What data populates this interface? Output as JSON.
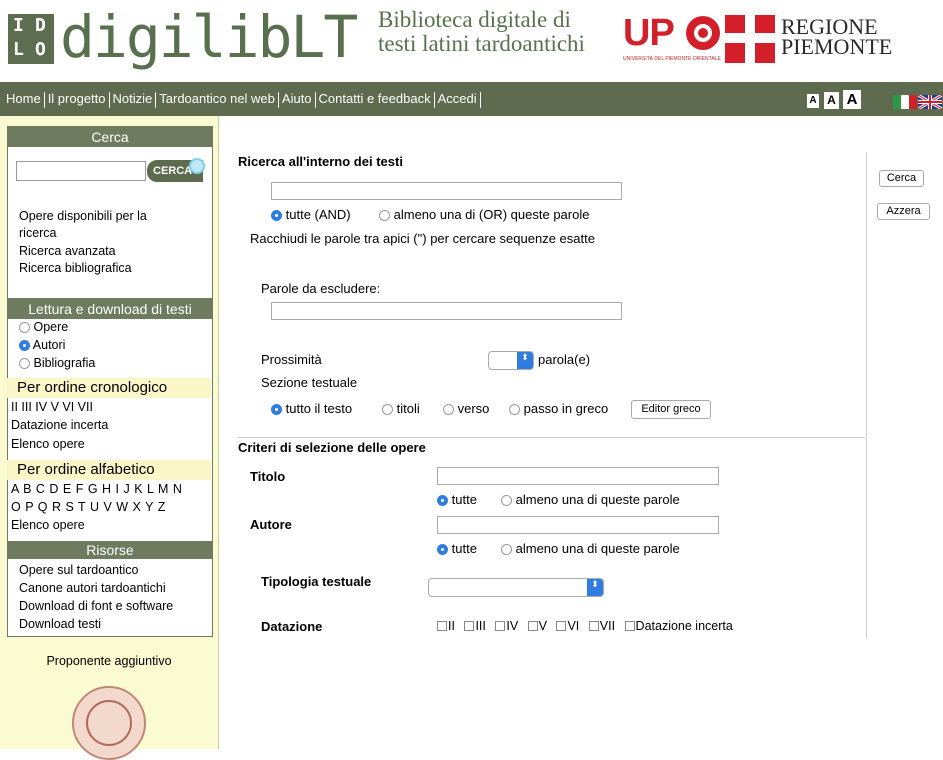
{
  "header": {
    "logo_letters": [
      "I",
      "D",
      "L",
      "O"
    ],
    "logo_word": "digilibLT",
    "subtitle_line1": "Biblioteca digitale di",
    "subtitle_line2": "testi latini tardoantichi",
    "upo_text": "UP",
    "upo_small": "UNIVERSITÀ DEL PIEMONTE ORIENTALE",
    "region_line1": "REGIONE",
    "region_line2": "PIEMONTE"
  },
  "nav": {
    "items": [
      "Home",
      "Il progetto",
      "Notizie",
      "Tardoantico nel web",
      "Aiuto",
      "Contatti e feedback",
      "Accedi"
    ],
    "font_sizes": [
      "A",
      "A",
      "A"
    ]
  },
  "sidebar": {
    "search": {
      "title": "Cerca",
      "button": "CERCA",
      "value": ""
    },
    "search_links": [
      "Opere disponibili per la",
      "ricerca",
      "Ricerca avanzata",
      "Ricerca bibliografica"
    ],
    "reading": {
      "title": "Lettura e download di testi",
      "options": [
        "Opere",
        "Autori",
        "Bibliografia"
      ],
      "selected": "Autori"
    },
    "chronological": {
      "title": "Per ordine cronologico",
      "centuries": "II  III  IV  V  VI  VII",
      "uncertain": "Datazione incerta",
      "list": "Elenco opere"
    },
    "alphabetical": {
      "title": "Per ordine alfabetico",
      "row1": "A B C D E F G H I J K L M N",
      "row2": "O P Q R S T U V W X Y Z",
      "list": "Elenco opere"
    },
    "resources": {
      "title": "Risorse",
      "items": [
        "Opere sul tardoantico",
        "Canone autori tardoantichi",
        "Download di font e software",
        "Download testi"
      ]
    },
    "proponent": "Proponente aggiuntivo"
  },
  "form": {
    "text_search_title": "Ricerca all'interno dei testi",
    "text_search_value": "",
    "mode_and": "tutte (AND)",
    "mode_or": "almeno una di (OR) queste parole",
    "quote_hint": "Racchiudi le parole tra apici (\") per cercare sequenze esatte",
    "exclude_label": "Parole da escludere:",
    "exclude_value": "",
    "proximity_label": "Prossimità",
    "proximity_unit": "parola(e)",
    "section_label": "Sezione testuale",
    "sections": [
      "tutto il testo",
      "titoli",
      "verso",
      "passo in greco"
    ],
    "selected_section": "tutto il testo",
    "greek_editor": "Editor greco",
    "criteria_title": "Criteri di selezione delle opere",
    "title_label": "Titolo",
    "author_label": "Autore",
    "all_words": "tutte",
    "any_words": "almeno una di queste parole",
    "typology_label": "Tipologia testuale",
    "typology_value": "",
    "dating_label": "Datazione",
    "dating_options": [
      "II",
      "III",
      "IV",
      "V",
      "VI",
      "VII",
      "Datazione incerta"
    ],
    "search_button": "Cerca",
    "reset_button": "Azzera"
  },
  "colors": {
    "nav": "#5e6b4e",
    "sidebar": "#fbfbd1",
    "box_head": "#6e7b5e",
    "accent": "#2f7de0",
    "logo": "#59704e",
    "upo_red": "#d21f2a"
  }
}
